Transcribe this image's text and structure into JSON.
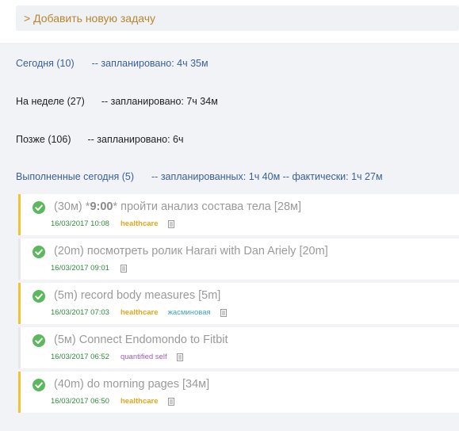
{
  "add_task": {
    "label": "> Добавить новую задачу"
  },
  "sections": {
    "today": {
      "title": "Сегодня (10)",
      "planned": "-- запланировано: 4ч 35м"
    },
    "week": {
      "title": "На неделе (27)",
      "planned": "-- запланировано: 7ч 34м"
    },
    "later": {
      "title": "Позже (106)",
      "planned": "-- запланировано: 6ч"
    },
    "done": {
      "title": "Выполненные сегодня (5)",
      "planned": "-- запланированных: 1ч 40м -- фактически: 1ч 27м"
    }
  },
  "tasks": [
    {
      "prefix": "(30м) *",
      "bold": "9:00",
      "suffix": "* пройти анализ состава тела [28м]",
      "date": "16/03/2017 10:08",
      "tags": [
        "healthcare"
      ]
    },
    {
      "prefix": "(20m) посмотреть ролик Harari with Dan Ariely [20m]",
      "date": "16/03/2017 09:01",
      "tags": []
    },
    {
      "prefix": "(5m) record body measures [5m]",
      "date": "16/03/2017 07:03",
      "tags": [
        "healthcare",
        "жасминовая"
      ]
    },
    {
      "prefix": "(5м) Connect Endomondo to Fitbit",
      "date": "16/03/2017 06:52",
      "tags": [
        "quantified self"
      ]
    },
    {
      "prefix": "(40m) do morning pages [34м]",
      "date": "16/03/2017 06:50",
      "tags": [
        "healthcare"
      ]
    }
  ],
  "colors": {
    "accent": "#3a5f9e",
    "check": "#5cb85c",
    "tag_healthcare": "#e0a81e",
    "tag_jasmine": "#3aa6b9",
    "tag_quantified_self": "#9a5fb3",
    "tagged_border": "#f4c430"
  },
  "icons": {
    "done": "check-circle-icon",
    "note": "note-icon"
  }
}
